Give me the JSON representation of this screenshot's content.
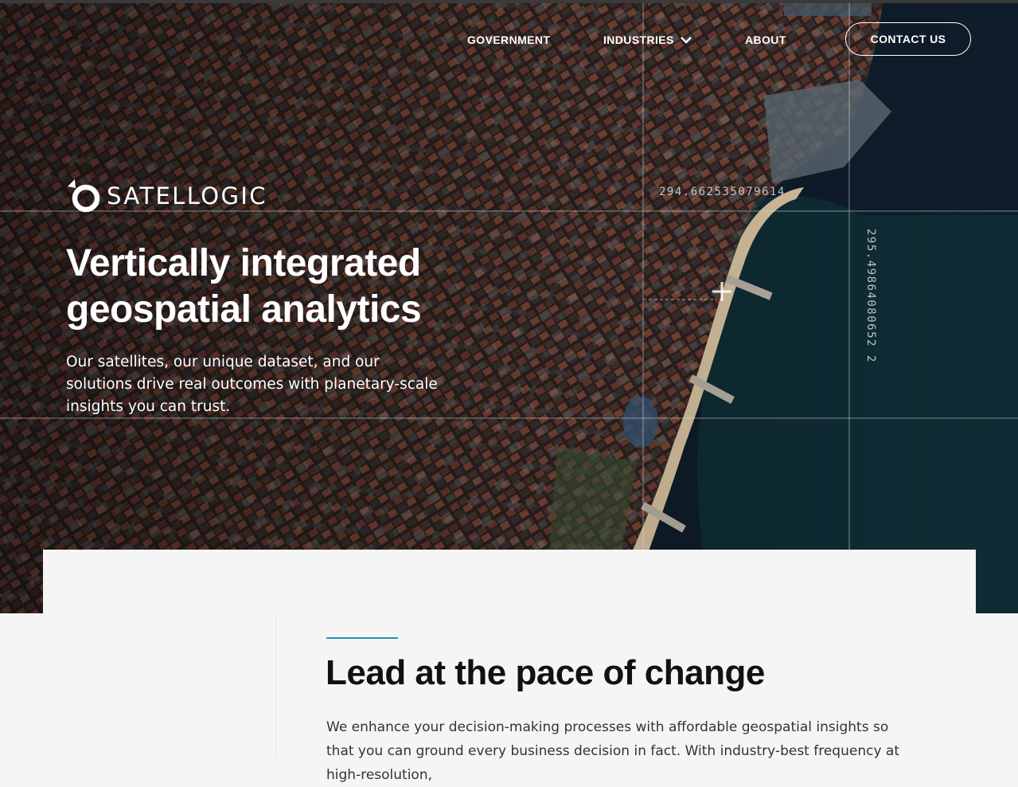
{
  "nav": {
    "items": [
      {
        "label": "GOVERNMENT"
      },
      {
        "label": "INDUSTRIES"
      },
      {
        "label": "ABOUT"
      }
    ],
    "contact_label": "CONTACT US"
  },
  "brand": {
    "name": "SATELLOGIC",
    "logo_icon": "satellogic-ring-icon"
  },
  "hero": {
    "title": "Vertically integrated geospatial analytics",
    "description": "Our satellites, our unique dataset, and our solutions drive real outcomes with planetary-scale insights you can trust.",
    "coordinate_x": "294.662535079614",
    "coordinate_y": "295.49864080652 2"
  },
  "section": {
    "title": "Lead at the pace of change",
    "body": "We enhance your decision-making processes with affordable geospatial insights so that you can ground every business decision in fact. With industry-best frequency at high-resolution,"
  },
  "colors": {
    "accent": "#1f97b3",
    "city": "#3a2a26",
    "ocean": "#0f1c2a",
    "beach": "#d8c3a0"
  }
}
